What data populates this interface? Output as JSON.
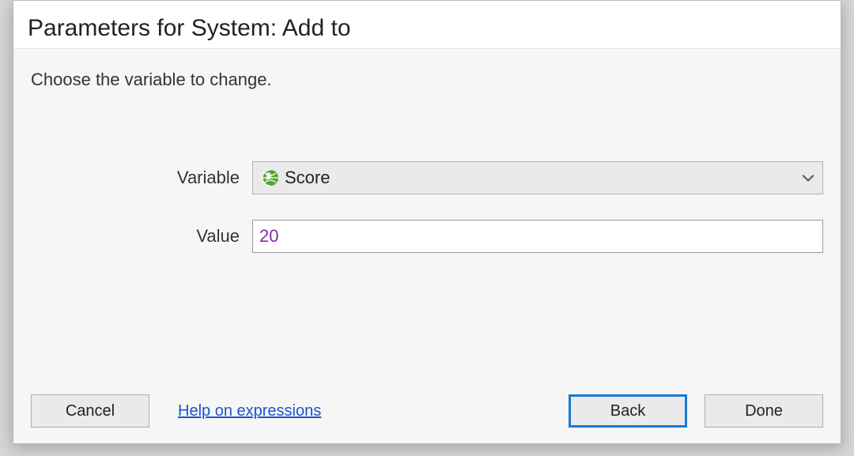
{
  "title": "Parameters for System: Add to",
  "instruction": "Choose the variable to change.",
  "form": {
    "variable_label": "Variable",
    "variable_value": "Score",
    "variable_icon": "globe-icon",
    "value_label": "Value",
    "value_value": "20"
  },
  "buttons": {
    "cancel": "Cancel",
    "help_link": "Help on expressions",
    "back": "Back",
    "done": "Done"
  }
}
